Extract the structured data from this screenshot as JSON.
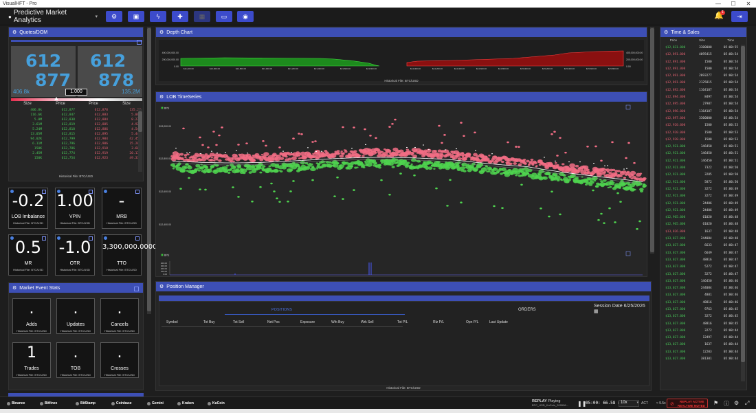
{
  "window": {
    "title": "VisualHFT - Pro",
    "controls": [
      "—",
      "☐",
      "✕"
    ]
  },
  "toolbar": {
    "workspace": "Predictive Market Analytics",
    "dropdown_icon": "▾",
    "buttons": [
      "⚙",
      "▣",
      "ϟ",
      "✚",
      "▦",
      "▭",
      "◉"
    ],
    "bell_count": "1"
  },
  "quotes": {
    "title": "Quotes/DOM",
    "bid_top": "612",
    "bid_bottom": "877",
    "ask_top": "612",
    "ask_bottom": "878",
    "bid_size": "406.8k",
    "ask_size": "135.2M",
    "spread": "1.000",
    "headers": [
      "Size",
      "Price",
      "Price",
      "Size"
    ],
    "rows": [
      [
        "406.8k",
        "612,877",
        "612,878",
        "135.2M"
      ],
      [
        "116.6K",
        "612,847",
        "612,883",
        "5.0GM"
      ],
      [
        "5.0M",
        "612,838",
        "612,884",
        "8.27M"
      ],
      [
        "3.61M",
        "612,819",
        "612,885",
        "4.92M"
      ],
      [
        "5.24M",
        "612,818",
        "612,886",
        "4.54M"
      ],
      [
        "13.05M",
        "612,815",
        "612,895",
        "5.44M"
      ],
      [
        "94.02K",
        "612,799",
        "612,904",
        "42.45M"
      ],
      [
        "6.11M",
        "612,796",
        "612,906",
        "15.28M"
      ],
      [
        "150K",
        "612,786",
        "612,918",
        "3.68M"
      ],
      [
        "2.45M",
        "612,774",
        "612,919",
        "20.17M"
      ],
      [
        "150K",
        "612,754",
        "612,923",
        "49.33M"
      ]
    ],
    "footer": "Historical File: BTC/USD"
  },
  "stats": [
    {
      "value": "-0.2",
      "label": "LOB Imbalance",
      "sub": "Historical File: BTC/USD"
    },
    {
      "value": "1.00",
      "label": "VPIN",
      "sub": "Historical File: BTC/USD"
    },
    {
      "value": "-",
      "label": "MRB",
      "sub": "Historical File: BTC/USD"
    },
    {
      "value": "0.5",
      "label": "MR",
      "sub": "Historical File: BTC/USD"
    },
    {
      "value": "-1.0",
      "label": "OTR",
      "sub": "Historical File: BTC/USD"
    },
    {
      "value": "3,300,000.0000",
      "label": "TTO",
      "sub": "Historical File: BTC/USD"
    }
  ],
  "market_events": {
    "title": "Market Event Stats",
    "items": [
      {
        "value": ".",
        "label": "Adds",
        "sub": "Historical File: BTC/USD"
      },
      {
        "value": ".",
        "label": "Updates",
        "sub": "Historical File: BTC/USD"
      },
      {
        "value": ".",
        "label": "Cancels",
        "sub": "Historical File: BTC/USD"
      },
      {
        "value": "1",
        "label": "Trades",
        "sub": "Historical File: BTC/USD"
      },
      {
        "value": ".",
        "label": "TOB",
        "sub": "Historical File: BTC/USD"
      },
      {
        "value": ".",
        "label": "Crosses",
        "sub": "Historical File: BTC/USD"
      }
    ]
  },
  "depth": {
    "title": "Depth Chart",
    "footer": "Historical File: BTC/USD",
    "ylabels_left": [
      "400,000,000.00",
      "200,000,000.00",
      "0.00"
    ],
    "ylabels_right": [
      "400,000,000.00",
      "200,000,000.00",
      "0.00"
    ],
    "xlabels": [
      "$11,400.00",
      "$12,600.00",
      "$12,800.00",
      "$13,000.00",
      "$13,200.00",
      "$13,400.00",
      "$13,600.00",
      "$13,800.00",
      "$14,000.00",
      "$14,200.00",
      "$14,400.00",
      "$14,600.00",
      "$14,800.00",
      "$15,000.00",
      "$15,200.00",
      "$15,400.00",
      "$15,600.00",
      "$15,800.00"
    ]
  },
  "lob": {
    "title": "LOB TimeSeries",
    "legend1": "BPU",
    "legend2": "BPU",
    "ylabels": [
      "$13,000.00",
      "$12,800.00",
      "$12,600.00",
      "$12,400.00",
      "$12,200.00"
    ],
    "vlabels": [
      "400.00",
      "300.00",
      "200.00",
      "100.00",
      "0.00"
    ]
  },
  "position": {
    "title": "Position Manager",
    "session_label": "Session Date",
    "session_date": "6/25/2026",
    "tab_positions": "POSITIONS",
    "tab_orders": "ORDERS",
    "columns": [
      "Symbol",
      "Tot Buy",
      "Tot Sell",
      "Net Pos",
      "Exposure",
      "Wrk Buy",
      "Wrk Sell",
      "Tot P/L",
      "Rlz P/L",
      "Opn P/L",
      "Last Update"
    ],
    "footer": "Historical File: BTC/USD"
  },
  "time_sales": {
    "title": "Time & Sales",
    "headers": [
      "Price",
      "Size",
      "Time"
    ],
    "rows": [
      [
        "$12,831.000",
        "3300000",
        "05:00:55",
        "g"
      ],
      [
        "$12,891.000",
        "4095415",
        "05:00:54",
        "r"
      ],
      [
        "$12,891.000",
        "1500",
        "05:00:54",
        "r"
      ],
      [
        "$12,891.000",
        "1500",
        "05:00:54",
        "r"
      ],
      [
        "$12,891.000",
        "2893277",
        "05:00:54",
        "r"
      ],
      [
        "$12,891.000",
        "2125815",
        "05:00:54",
        "r"
      ],
      [
        "$12,892.000",
        "1164187",
        "05:00:54",
        "r"
      ],
      [
        "$12,894.000",
        "8497",
        "05:00:54",
        "r"
      ],
      [
        "$12,895.000",
        "27987",
        "05:00:54",
        "r"
      ],
      [
        "$12,896.000",
        "1164187",
        "05:00:54",
        "r"
      ],
      [
        "$12,897.000",
        "3300000",
        "05:00:54",
        "r"
      ],
      [
        "$12,920.000",
        "1500",
        "05:00:53",
        "r"
      ],
      [
        "$12,920.000",
        "1500",
        "05:00:53",
        "r"
      ],
      [
        "$12,920.000",
        "1500",
        "05:00:53",
        "r"
      ],
      [
        "$12,921.000",
        "146450",
        "05:00:51",
        "g"
      ],
      [
        "$12,921.000",
        "146450",
        "05:00:51",
        "g"
      ],
      [
        "$12,921.000",
        "146450",
        "05:00:51",
        "g"
      ],
      [
        "$12,921.000",
        "7322",
        "05:00:50",
        "g"
      ],
      [
        "$12,921.000",
        "3285",
        "05:00:50",
        "g"
      ],
      [
        "$12,921.000",
        "5872",
        "05:00:50",
        "g"
      ],
      [
        "$12,921.000",
        "3272",
        "05:00:49",
        "g"
      ],
      [
        "$12,921.000",
        "3272",
        "05:00:49",
        "g"
      ],
      [
        "$12,921.000",
        "24406",
        "05:00:49",
        "g"
      ],
      [
        "$12,921.000",
        "24406",
        "05:00:49",
        "g"
      ],
      [
        "$12,965.000",
        "61020",
        "05:00:48",
        "g"
      ],
      [
        "$12,965.000",
        "61020",
        "05:00:48",
        "g"
      ],
      [
        "$13,026.000",
        "1637",
        "05:00:48",
        "r"
      ],
      [
        "$13,027.000",
        "244084",
        "05:00:48",
        "g"
      ],
      [
        "$13,027.000",
        "6633",
        "05:00:47",
        "g"
      ],
      [
        "$13,027.000",
        "6649",
        "05:00:47",
        "g"
      ],
      [
        "$13,027.000",
        "48816",
        "05:00:47",
        "g"
      ],
      [
        "$13,027.000",
        "5272",
        "05:00:47",
        "g"
      ],
      [
        "$13,027.000",
        "3272",
        "05:00:47",
        "g"
      ],
      [
        "$13,027.000",
        "146450",
        "05:00:46",
        "g"
      ],
      [
        "$13,027.000",
        "244084",
        "05:00:46",
        "g"
      ],
      [
        "$13,027.000",
        "4881",
        "05:00:46",
        "g"
      ],
      [
        "$13,027.000",
        "48816",
        "05:00:46",
        "g"
      ],
      [
        "$13,027.000",
        "9763",
        "05:00:45",
        "g"
      ],
      [
        "$13,027.000",
        "3272",
        "05:00:45",
        "g"
      ],
      [
        "$13,027.000",
        "48816",
        "05:00:45",
        "g"
      ],
      [
        "$13,027.000",
        "3272",
        "05:00:44",
        "g"
      ],
      [
        "$13,027.000",
        "12497",
        "05:00:44",
        "g"
      ],
      [
        "$13,027.000",
        "1637",
        "05:00:44",
        "g"
      ],
      [
        "$13,027.000",
        "12203",
        "05:00:44",
        "g"
      ],
      [
        "$13,027.000",
        "381301",
        "05:00:44",
        "g"
      ]
    ]
  },
  "bottom": {
    "exchanges": [
      "Binance",
      "Bitfinex",
      "BitStamp",
      "Coinbase",
      "Gemini",
      "Kraken",
      "KuCoin"
    ],
    "replay_label": "REPLAY",
    "replay_status": "Playing",
    "replay_file": "BTC_USD_KuCoin_202606...",
    "replay_time": "05:00:",
    "replay_ms": "66.58",
    "replay_unit": "REG",
    "speed": "10x",
    "act": "ACT",
    "rate": "≈ 9.5x",
    "alert_line1": "REPLAY ACTIVE",
    "alert_line2": "REALTIME MUTED"
  }
}
